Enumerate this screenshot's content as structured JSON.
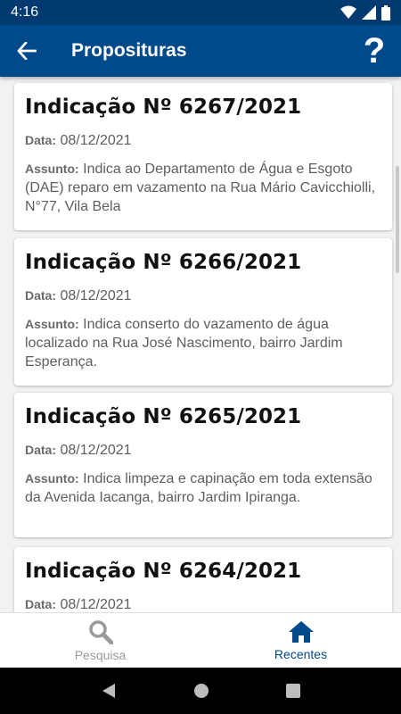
{
  "status_bar": {
    "time": "4:16"
  },
  "app_bar": {
    "title": "Proposituras",
    "help_label": "?"
  },
  "labels": {
    "date": "Data:",
    "subject": "Assunto:"
  },
  "cards": [
    {
      "title": "Indicação Nº 6267/2021",
      "date": "08/12/2021",
      "subject": "Indica ao Departamento de Água e Esgoto (DAE) reparo em vazamento na Rua Mário Cavicchiolli, N°77, Vila Bela"
    },
    {
      "title": "Indicação Nº 6266/2021",
      "date": "08/12/2021",
      "subject": "Indica conserto do vazamento de água localizado na Rua José Nascimento, bairro Jardim Esperança."
    },
    {
      "title": "Indicação Nº 6265/2021",
      "date": "08/12/2021",
      "subject": "Indica limpeza e capinação em toda extensão da Avenida Iacanga, bairro Jardim Ipiranga."
    },
    {
      "title": "Indicação Nº 6264/2021",
      "date": "08/12/2021",
      "subject": ""
    }
  ],
  "bottom_nav": {
    "items": [
      {
        "label": "Pesquisa",
        "icon": "search-icon",
        "active": false
      },
      {
        "label": "Recentes",
        "icon": "home-icon",
        "active": true
      }
    ]
  },
  "colors": {
    "primary": "#00498b",
    "status_bar": "#003a70",
    "inactive": "#9a9a9a"
  }
}
